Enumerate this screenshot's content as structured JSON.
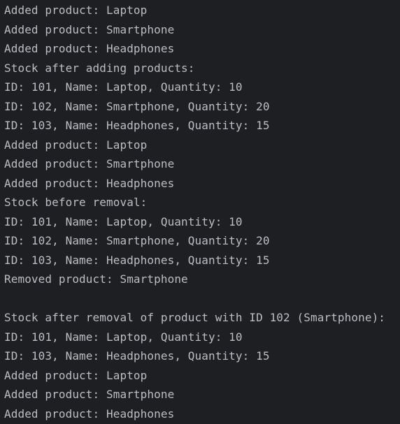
{
  "console": {
    "lines": [
      "Added product: Laptop",
      "Added product: Smartphone",
      "Added product: Headphones",
      "Stock after adding products:",
      "ID: 101, Name: Laptop, Quantity: 10",
      "ID: 102, Name: Smartphone, Quantity: 20",
      "ID: 103, Name: Headphones, Quantity: 15",
      "Added product: Laptop",
      "Added product: Smartphone",
      "Added product: Headphones",
      "Stock before removal:",
      "ID: 101, Name: Laptop, Quantity: 10",
      "ID: 102, Name: Smartphone, Quantity: 20",
      "ID: 103, Name: Headphones, Quantity: 15",
      "Removed product: Smartphone",
      "",
      "Stock after removal of product with ID 102 (Smartphone):",
      "ID: 101, Name: Laptop, Quantity: 10",
      "ID: 103, Name: Headphones, Quantity: 15",
      "Added product: Laptop",
      "Added product: Smartphone",
      "Added product: Headphones"
    ]
  }
}
